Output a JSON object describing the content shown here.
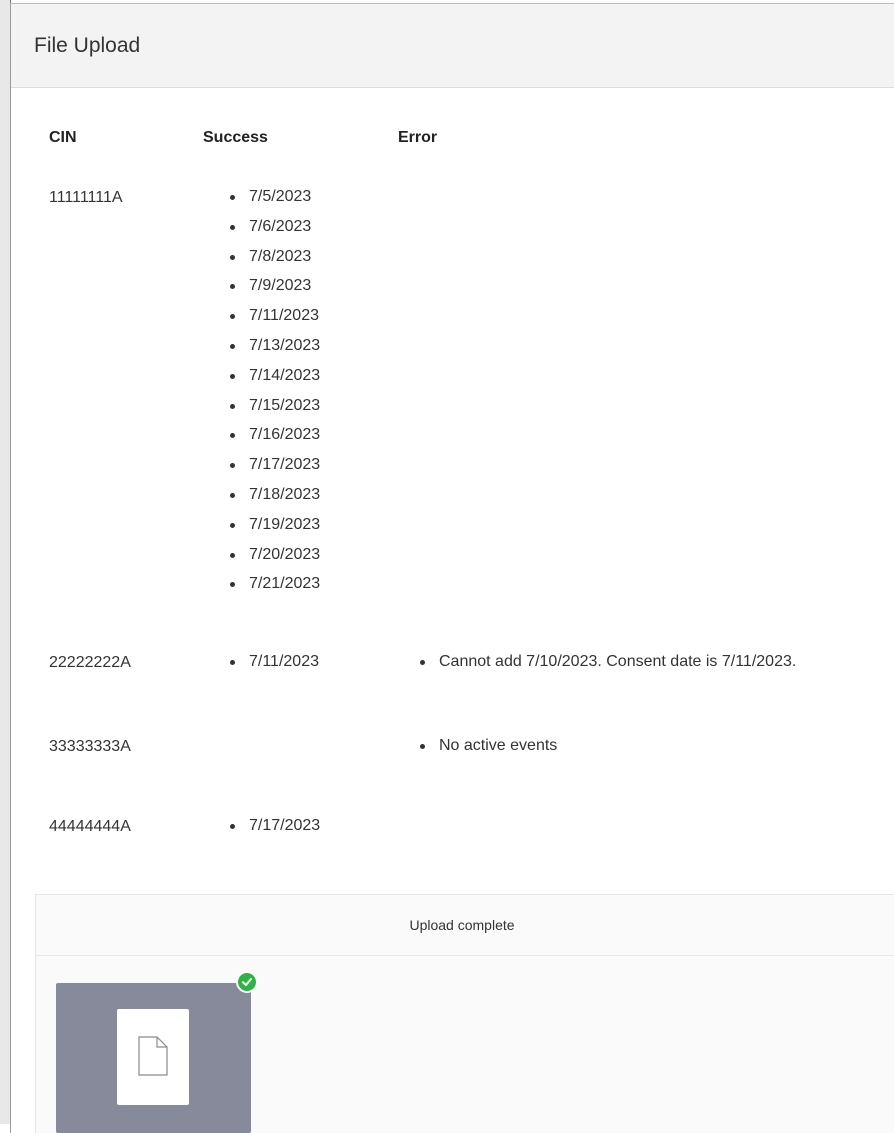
{
  "modal": {
    "title": "File Upload"
  },
  "table": {
    "columns": [
      "CIN",
      "Success",
      "Error"
    ],
    "rows": [
      {
        "cin": "11111111A",
        "success": [
          "7/5/2023",
          "7/6/2023",
          "7/8/2023",
          "7/9/2023",
          "7/11/2023",
          "7/13/2023",
          "7/14/2023",
          "7/15/2023",
          "7/16/2023",
          "7/17/2023",
          "7/18/2023",
          "7/19/2023",
          "7/20/2023",
          "7/21/2023"
        ],
        "errors": []
      },
      {
        "cin": "22222222A",
        "success": [
          "7/11/2023"
        ],
        "errors": [
          "Cannot add 7/10/2023. Consent date is 7/11/2023."
        ]
      },
      {
        "cin": "33333333A",
        "success": [],
        "errors": [
          "No active events"
        ]
      },
      {
        "cin": "44444444A",
        "success": [
          "7/17/2023"
        ],
        "errors": []
      }
    ]
  },
  "upload": {
    "status": "Upload complete",
    "file_icon": "file-icon",
    "complete_icon": "check-circle-icon",
    "accent_color": "#2fb344"
  }
}
